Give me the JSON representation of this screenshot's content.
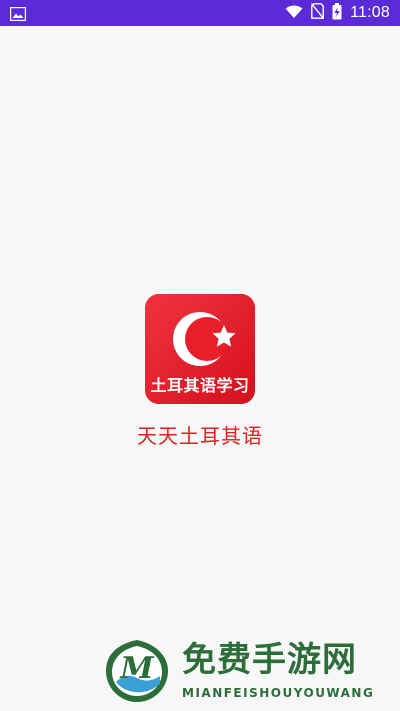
{
  "status_bar": {
    "time": "11:08",
    "icons": [
      "image-notification-icon",
      "wifi-icon",
      "no-sim-icon",
      "battery-charging-icon"
    ],
    "background_color": "#5a2bd6"
  },
  "splash": {
    "icon_label": "土耳其语学习",
    "app_name": "天天土耳其语",
    "icon_color": "#e30a17",
    "app_name_color": "#e02020"
  },
  "watermark": {
    "title": "免费手游网",
    "subtitle": "MIANFEISHOUYOUWANG",
    "logo_letter": "M",
    "color": "#2c6e3a"
  }
}
